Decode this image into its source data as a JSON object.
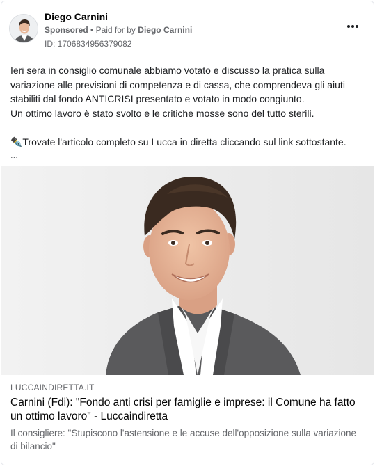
{
  "post": {
    "author": "Diego Carnini",
    "sponsored_label": "Sponsored",
    "separator": "•",
    "paid_for_label": "Paid for by",
    "payer": "Diego Carnini",
    "ad_id": "ID: 1706834956379082",
    "more_icon": "more-horizontal-icon",
    "text_lines": [
      "Ieri sera in consiglio comunale abbiamo votato e discusso la pratica sulla",
      "variazione alle previsioni di competenza e di cassa, che comprendeva gli aiuti",
      "stabiliti dal fondo ANTICRISI presentato e votato in modo congiunto.",
      "Un ottimo lavoro è stato svolto e le critiche mosse sono del tutto sterili."
    ],
    "text_link_line": "✒️Trovate l'articolo completo su Lucca in diretta cliccando sul link sottostante.",
    "truncation": "..."
  },
  "link_preview": {
    "domain": "LUCCAINDIRETTA.IT",
    "title": "Carnini (Fdi): \"Fondo anti crisi per famiglie e imprese: il Comune ha fatto un ottimo lavoro\" - Luccaindiretta",
    "description": "Il consigliere: \"Stupiscono l'astensione e le accuse dell'opposizione sulla variazione di bilancio\""
  },
  "colors": {
    "text_primary": "#050505",
    "text_secondary": "#65676b",
    "border": "#e4e6eb",
    "photo_background": "#efefef",
    "jacket": "#5a5a5c",
    "shirt": "#ffffff",
    "hair": "#3a2a20",
    "skin": "#e8b89a"
  }
}
